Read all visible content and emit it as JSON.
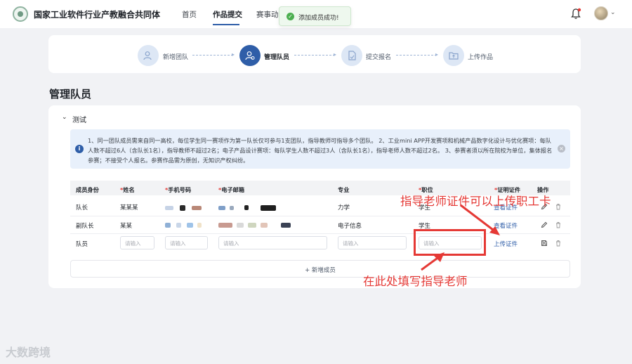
{
  "header": {
    "brand": "国家工业软件行业产教融合共同体",
    "nav": [
      {
        "label": "首页"
      },
      {
        "label": "作品提交"
      },
      {
        "label": "赛事动态"
      }
    ]
  },
  "toast": {
    "message": "添加成员成功!"
  },
  "steps": [
    {
      "label": "新增团队",
      "icon": "add-user-icon"
    },
    {
      "label": "管理队员",
      "icon": "team-icon"
    },
    {
      "label": "提交报名",
      "icon": "document-icon"
    },
    {
      "label": "上传作品",
      "icon": "upload-folder-icon"
    }
  ],
  "page_title": "管理队员",
  "team": {
    "name": "测试"
  },
  "notice": {
    "text": "1、同一团队成员需来自同一高校，每位学生同一赛项作为第一队长仅可参与1支团队，指导教师可指导多个团队。 2、工业mini APP开发赛项和机械产品数字化设计与优化赛项：每队人数不超过6人（含队长1名），指导教师不超过2名；电子产品设计赛项：每队学生人数不超过3人（含队长1名），指导老师人数不超过2名。 3、参赛者须以所在院校为单位，集体报名参赛；不接受个人报名。参赛作品需为原创，无知识产权纠纷。"
  },
  "table": {
    "headers": [
      {
        "label": "成员身份",
        "required": ""
      },
      {
        "label": "姓名",
        "required": "*"
      },
      {
        "label": "手机号码",
        "required": "*"
      },
      {
        "label": "电子邮箱",
        "required": "*"
      },
      {
        "label": "专业",
        "required": ""
      },
      {
        "label": "职位",
        "required": "*"
      },
      {
        "label": "证明证件",
        "required": "*"
      },
      {
        "label": "操作",
        "required": ""
      }
    ],
    "rows": [
      {
        "role": "队长",
        "name": "某某某",
        "major": "力学",
        "position": "学生",
        "cert": "查看证件"
      },
      {
        "role": "副队长",
        "name": "某某",
        "major": "电子信息",
        "position": "学生",
        "cert": "查看证件"
      },
      {
        "role": "队员",
        "cert": "上传证件"
      }
    ],
    "input_placeholder": "请输入"
  },
  "add_member": {
    "label": "+ 新增成员"
  },
  "annotations": {
    "top": "指导老师证件可以上传职工卡",
    "bottom": "在此处填写指导老师"
  },
  "watermark": "大数跨境",
  "colors": {
    "primary": "#2f5ea8",
    "annotation": "#e53935",
    "success": "#4caf50"
  }
}
